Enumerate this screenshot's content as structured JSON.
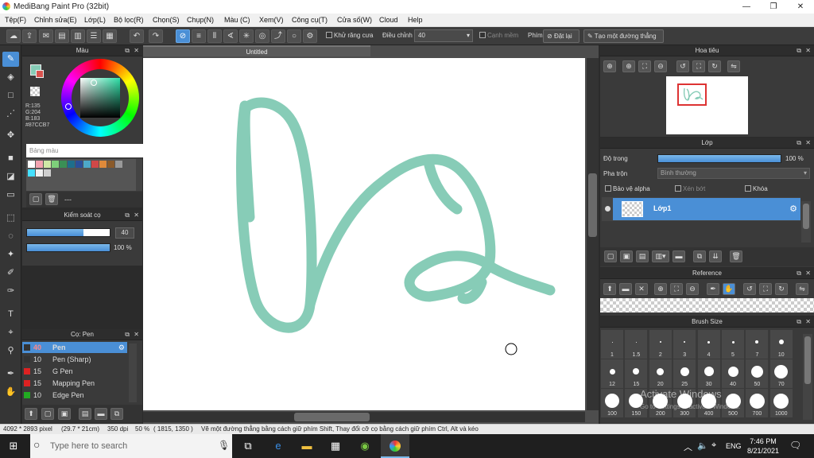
{
  "window": {
    "title": "MediBang Paint Pro (32bit)",
    "minimize": "—",
    "maximize": "❐",
    "close": "✕"
  },
  "menu": [
    "Tệp(F)",
    "Chỉnh sửa(E)",
    "Lớp(L)",
    "Bộ lọc(R)",
    "Chọn(S)",
    "Chụp(N)",
    "Màu (C)",
    "Xem(V)",
    "Công cụ(T)",
    "Cửa số(W)",
    "Cloud",
    "Help"
  ],
  "toolbar": {
    "antialias_label": "Khử răng cưa",
    "dieu_chinh_label": "Điều chỉnh",
    "dieu_chinh_value": "40",
    "canh_mem_label": "Cạnh mềm",
    "phim_label": "Phím",
    "dat_lai_label": "Đặt lại",
    "straight_line_label": "Tạo một đường thẳng"
  },
  "color_panel": {
    "title": "Màu",
    "r": "R:135",
    "g": "G:204",
    "b": "B:183",
    "hex": "#87CCB7",
    "palette_label": "Bảng màu",
    "current_color": "#87CCB7",
    "secondary_color": "#d9534f",
    "palette_colors": [
      "#ffffff",
      "#f2a3b0",
      "#cfe8a6",
      "#7ecf7a",
      "#3a8f55",
      "#1e6e8c",
      "#2b4f9a",
      "#4da8c9",
      "#d04848",
      "#e08a3a",
      "#8a5a2a",
      "#999999",
      "#45e0ff",
      "#f0f0f0",
      "#cfcfcf"
    ],
    "palette_footer": "---"
  },
  "brush_control": {
    "title": "Kiểm soát cọ",
    "size_value": "40",
    "size_fraction": 0.68,
    "opacity_value": "100 %",
    "opacity_fraction": 1.0
  },
  "brush_list": {
    "title": "Cọ: Pen",
    "items": [
      {
        "size": "40",
        "name": "Pen",
        "color": "#333333",
        "selected": true
      },
      {
        "size": "10",
        "name": "Pen (Sharp)",
        "color": "#333333",
        "selected": false
      },
      {
        "size": "15",
        "name": "G Pen",
        "color": "#dd2222",
        "selected": false
      },
      {
        "size": "15",
        "name": "Mapping Pen",
        "color": "#dd2222",
        "selected": false
      },
      {
        "size": "10",
        "name": "Edge Pen",
        "color": "#22aa22",
        "selected": false
      }
    ]
  },
  "canvas": {
    "tab_title": "Untitled",
    "stroke_color": "#87CCB7"
  },
  "navigator": {
    "title": "Hoa tiêu"
  },
  "layer_panel": {
    "title": "Lớp",
    "opacity_label": "Độ trong",
    "opacity_value": "100 %",
    "opacity_fraction": 1.0,
    "blend_label": "Pha trộn",
    "blend_value": "Bình thường",
    "protect_alpha": "Bảo vệ alpha",
    "clipping": "Xén bớt",
    "lock": "Khóa",
    "layer_name": "Lớp1"
  },
  "reference": {
    "title": "Reference"
  },
  "brush_size": {
    "title": "Brush Size",
    "row1": [
      "1",
      "1.5",
      "2",
      "3",
      "4",
      "5",
      "7",
      "10"
    ],
    "row2": [
      "12",
      "15",
      "20",
      "25",
      "30",
      "40",
      "50",
      "70"
    ],
    "row3": [
      "100",
      "150",
      "200",
      "300",
      "400",
      "500",
      "700",
      "1000"
    ]
  },
  "status": {
    "dimensions": "4092 * 2893 pixel",
    "size_cm": "(29.7 * 21cm)",
    "dpi": "350 dpi",
    "zoom": "50 %",
    "coords": "( 1815, 1350 )",
    "hint": "Vẽ một đường thẳng bằng cách giữ phím Shift, Thay đổi cỡ cọ bằng cách giữ phím Ctrl, Alt và kéo"
  },
  "watermark": {
    "line1": "Activate Windows",
    "line2": "Go to Settings to activate Windows."
  },
  "taskbar": {
    "search_placeholder": "Type here to search",
    "lang": "ENG",
    "time": "7:46 PM",
    "date": "8/21/2021"
  }
}
